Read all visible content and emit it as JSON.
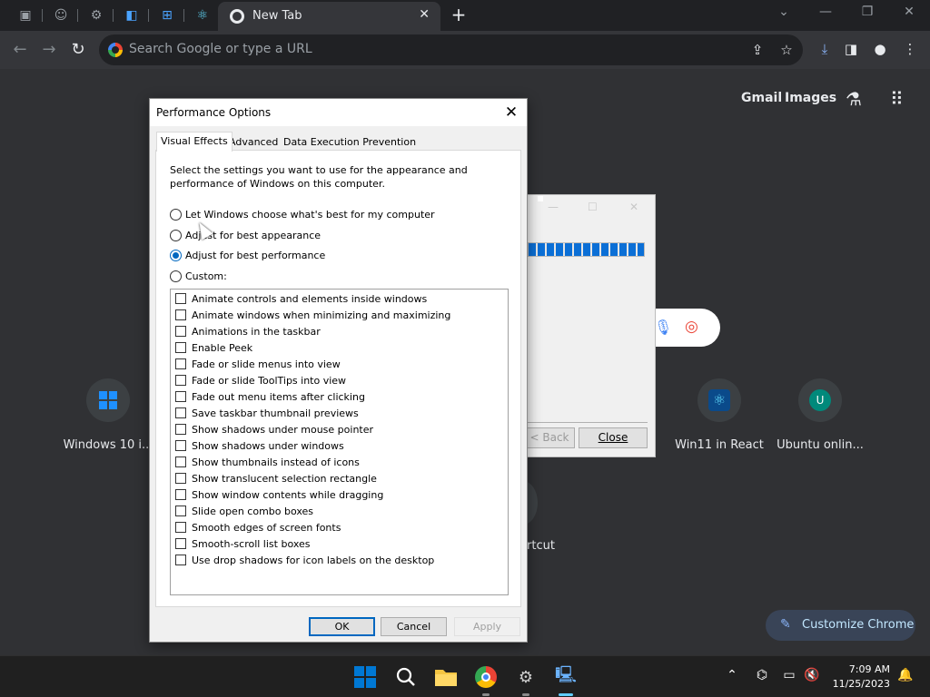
{
  "browser": {
    "active_tab_title": "New Tab",
    "omnibox_placeholder": "Search Google or type a URL"
  },
  "ntp": {
    "gmail_link": "Gmail",
    "images_link": "Images",
    "shortcuts": [
      {
        "label": "Windows 10 i..."
      },
      {
        "label": "Win11 in React"
      },
      {
        "label": "Ubuntu onlin..."
      },
      {
        "label": "rtcut"
      }
    ],
    "ubuntu_avatar_letter": "U",
    "customize_label": "Customize Chrome"
  },
  "background_window": {
    "progress_percent": 100,
    "back_label": "< Back",
    "close_label": "Close"
  },
  "dialog": {
    "title": "Performance Options",
    "tabs": [
      "Visual Effects",
      "Advanced",
      "Data Execution Prevention"
    ],
    "active_tab": "Visual Effects",
    "intro": "Select the settings you want to use for the appearance and performance of Windows on this computer.",
    "radio_options": [
      {
        "label": "Let Windows choose what's best for my computer",
        "selected": false
      },
      {
        "label": "Adjust for best appearance",
        "selected": false
      },
      {
        "label": "Adjust for best performance",
        "selected": true
      },
      {
        "label": "Custom:",
        "selected": false
      }
    ],
    "effects": [
      {
        "label": "Animate controls and elements inside windows",
        "checked": false
      },
      {
        "label": "Animate windows when minimizing and maximizing",
        "checked": false
      },
      {
        "label": "Animations in the taskbar",
        "checked": false
      },
      {
        "label": "Enable Peek",
        "checked": false
      },
      {
        "label": "Fade or slide menus into view",
        "checked": false
      },
      {
        "label": "Fade or slide ToolTips into view",
        "checked": false
      },
      {
        "label": "Fade out menu items after clicking",
        "checked": false
      },
      {
        "label": "Save taskbar thumbnail previews",
        "checked": false
      },
      {
        "label": "Show shadows under mouse pointer",
        "checked": false
      },
      {
        "label": "Show shadows under windows",
        "checked": false
      },
      {
        "label": "Show thumbnails instead of icons",
        "checked": false
      },
      {
        "label": "Show translucent selection rectangle",
        "checked": false
      },
      {
        "label": "Show window contents while dragging",
        "checked": false
      },
      {
        "label": "Slide open combo boxes",
        "checked": false
      },
      {
        "label": "Smooth edges of screen fonts",
        "checked": false
      },
      {
        "label": "Smooth-scroll list boxes",
        "checked": false
      },
      {
        "label": "Use drop shadows for icon labels on the desktop",
        "checked": false
      }
    ],
    "buttons": {
      "ok": "OK",
      "cancel": "Cancel",
      "apply": "Apply"
    }
  },
  "taskbar": {
    "time": "7:09 AM",
    "date": "11/25/2023"
  },
  "colors": {
    "accent": "#0067c0",
    "windows_blue": "#0078d4",
    "progress": "#0b6fd6",
    "chrome_bg": "#303134"
  }
}
